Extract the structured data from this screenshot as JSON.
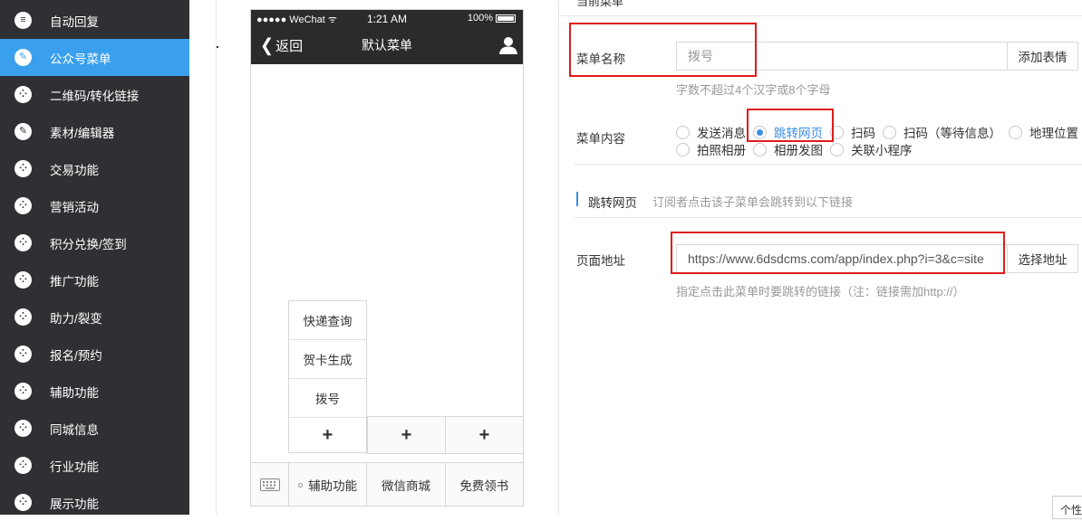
{
  "sidebar": {
    "items": [
      {
        "label": "自动回复",
        "icon": "chat-icon",
        "active": false
      },
      {
        "label": "公众号菜单",
        "icon": "document-icon",
        "active": true
      },
      {
        "label": "二维码/转化链接",
        "icon": "grid-icon",
        "active": false
      },
      {
        "label": "素材/编辑器",
        "icon": "pencil-icon",
        "active": false
      },
      {
        "label": "交易功能",
        "icon": "grid-icon",
        "active": false
      },
      {
        "label": "营销活动",
        "icon": "grid-icon",
        "active": false
      },
      {
        "label": "积分兑换/签到",
        "icon": "grid-icon",
        "active": false
      },
      {
        "label": "推广功能",
        "icon": "grid-icon",
        "active": false
      },
      {
        "label": "助力/裂变",
        "icon": "grid-icon",
        "active": false
      },
      {
        "label": "报名/预约",
        "icon": "grid-icon",
        "active": false
      },
      {
        "label": "辅助功能",
        "icon": "grid-icon",
        "active": false
      },
      {
        "label": "同城信息",
        "icon": "grid-icon",
        "active": false
      },
      {
        "label": "行业功能",
        "icon": "grid-icon",
        "active": false
      },
      {
        "label": "展示功能",
        "icon": "grid-icon",
        "active": false
      }
    ]
  },
  "phone": {
    "status_left": "●●●●● WeChat",
    "time": "1:21 AM",
    "battery": "100%",
    "back_label": "返回",
    "title": "默认菜单",
    "submenu": [
      "快递查询",
      "贺卡生成",
      "拨号"
    ],
    "plus": "+",
    "bottom_menus": [
      "辅助功能",
      "微信商城",
      "免费领书"
    ]
  },
  "form": {
    "top_label": "当前菜单",
    "name_label": "菜单名称",
    "name_value": "拨号",
    "emoji_button": "添加表情",
    "name_hint": "字数不超过4个汉字或8个字母",
    "content_label": "菜单内容",
    "radios_row1": [
      "发送消息",
      "跳转网页",
      "扫码",
      "扫码（等待信息）",
      "地理位置"
    ],
    "radios_row2": [
      "拍照相册",
      "相册发图",
      "关联小程序"
    ],
    "selected": "跳转网页",
    "section_title": "跳转网页",
    "section_desc": "订阅者点击该子菜单会跳转到以下链接",
    "url_label": "页面地址",
    "url_value": "https://www.6dsdcms.com/app/index.php?i=3&c=site",
    "url_button": "选择地址",
    "url_hint": "指定点击此菜单时要跳转的链接（注：链接需加http://）",
    "corner_label": "个性"
  },
  "colors": {
    "sidebar_bg": "#2f3033",
    "active_bg": "#3aa0ee",
    "accent": "#3a8ee6",
    "highlight_red": "#e01b1b"
  }
}
